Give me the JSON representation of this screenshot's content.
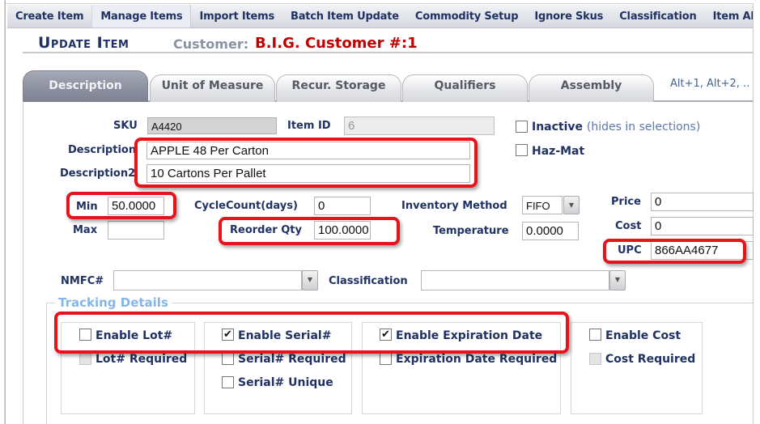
{
  "top_nav": {
    "items": [
      {
        "label": "Create Item",
        "active": false
      },
      {
        "label": "Manage Items",
        "active": true
      },
      {
        "label": "Import Items",
        "active": false
      },
      {
        "label": "Batch Item Update",
        "active": false
      },
      {
        "label": "Commodity Setup",
        "active": false
      },
      {
        "label": "Ignore Skus",
        "active": false
      },
      {
        "label": "Classification",
        "active": false
      },
      {
        "label": "Item Alias",
        "active": false
      }
    ]
  },
  "header": {
    "title": "Update Item",
    "customer_label": "Customer:",
    "customer_name": "B.I.G. Customer #:1"
  },
  "tabs": {
    "items": [
      {
        "label": "Description",
        "active": true
      },
      {
        "label": "Unit of Measure",
        "active": false
      },
      {
        "label": "Recur. Storage",
        "active": false
      },
      {
        "label": "Qualifiers",
        "active": false
      },
      {
        "label": "Assembly",
        "active": false
      }
    ],
    "shortcut_hint": "Alt+1, Alt+2, .."
  },
  "form": {
    "sku": {
      "label": "SKU",
      "value": "A4420"
    },
    "item_id": {
      "label": "Item ID",
      "value": "6"
    },
    "inactive": {
      "label": "Inactive",
      "note": "(hides in selections)",
      "checked": false
    },
    "haz_mat": {
      "label": "Haz-Mat",
      "checked": false
    },
    "description": {
      "label": "Description",
      "value": "APPLE 48 Per Carton"
    },
    "description2": {
      "label": "Description2",
      "value": "10 Cartons Per Pallet"
    },
    "min": {
      "label": "Min",
      "value": "50.0000"
    },
    "max": {
      "label": "Max",
      "value": ""
    },
    "cycle_count": {
      "label": "CycleCount(days)",
      "value": "0"
    },
    "reorder_qty": {
      "label": "Reorder Qty",
      "value": "100.0000"
    },
    "inventory_method": {
      "label": "Inventory Method",
      "value": "FIFO"
    },
    "temperature": {
      "label": "Temperature",
      "value": "0.0000"
    },
    "price": {
      "label": "Price",
      "value": "0"
    },
    "cost": {
      "label": "Cost",
      "value": "0"
    },
    "upc": {
      "label": "UPC",
      "value": "866AA4677"
    },
    "nmfc": {
      "label": "NMFC#",
      "value": ""
    },
    "classification": {
      "label": "Classification",
      "value": ""
    }
  },
  "tracking": {
    "legend": "Tracking Details",
    "lot": {
      "enable": {
        "label": "Enable Lot#",
        "checked": false
      },
      "required": {
        "label": "Lot# Required",
        "checked": false,
        "disabled": true
      }
    },
    "serial": {
      "enable": {
        "label": "Enable Serial#",
        "checked": true
      },
      "required": {
        "label": "Serial# Required",
        "checked": false
      },
      "unique": {
        "label": "Serial# Unique",
        "checked": false
      }
    },
    "expiration": {
      "enable": {
        "label": "Enable Expiration Date",
        "checked": true
      },
      "required": {
        "label": "Expiration Date Required",
        "checked": false
      }
    },
    "cost": {
      "enable": {
        "label": "Enable Cost",
        "checked": false
      },
      "required": {
        "label": "Cost Required",
        "checked": false,
        "disabled": true
      }
    }
  },
  "icons": {
    "dropdown": "▼",
    "check": "✔"
  },
  "colors": {
    "label": "#1f3263",
    "customer_name": "#c00000",
    "highlight": "#e8121a",
    "legend": "#86b6e8"
  }
}
